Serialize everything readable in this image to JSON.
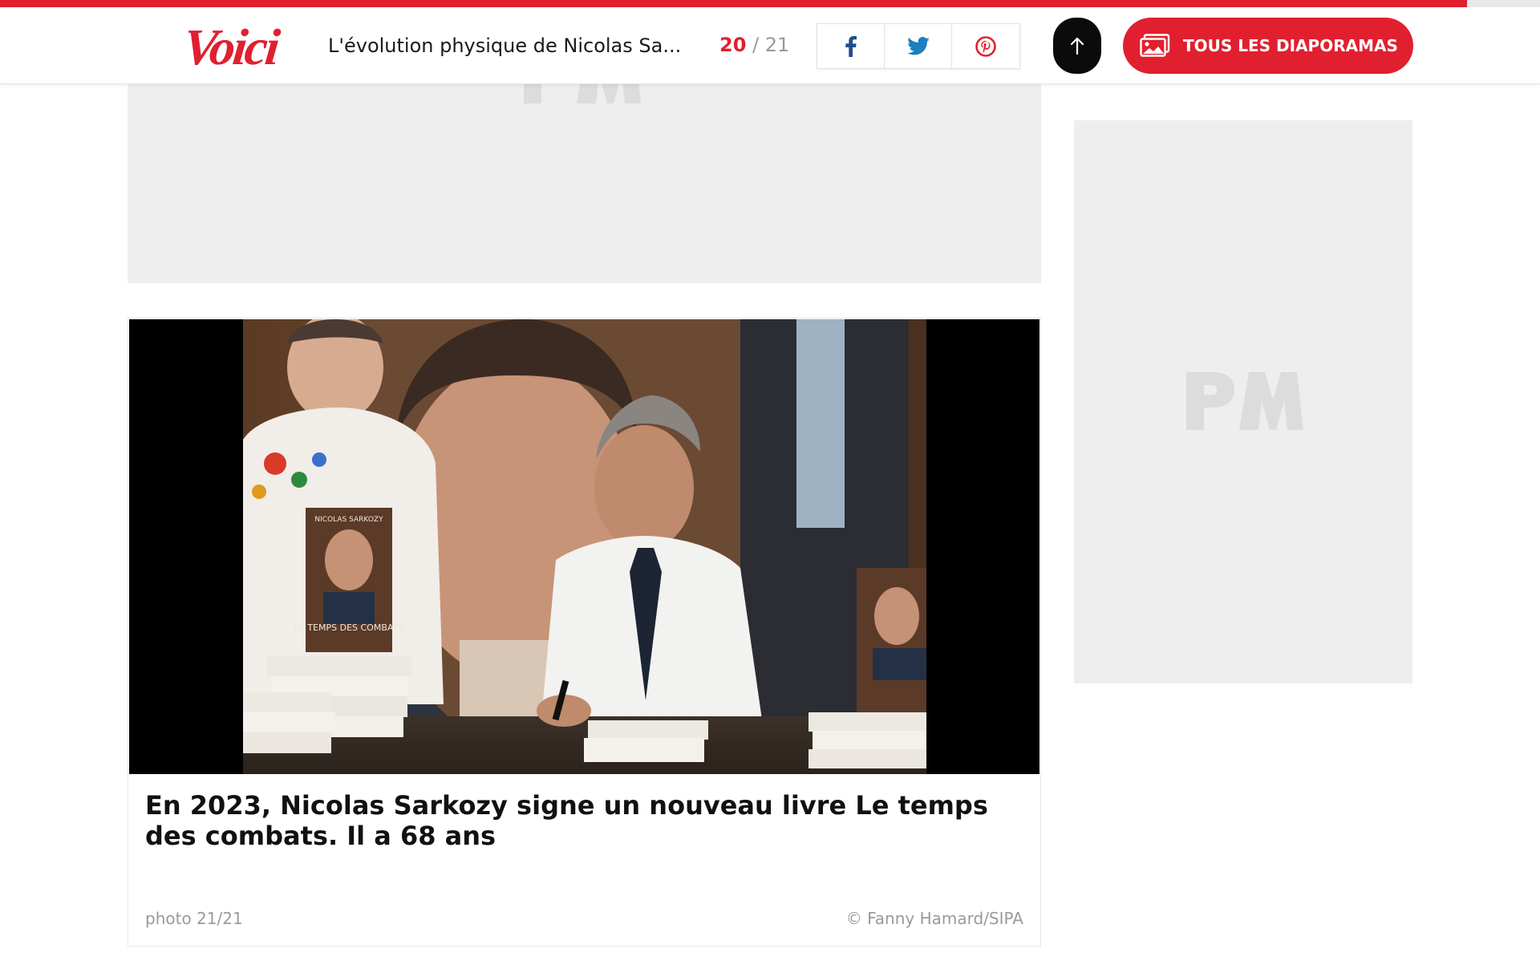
{
  "progress": {
    "fraction": 0.9524
  },
  "header": {
    "logo": "Voici",
    "slide_title": "L'évolution physique de Nicolas Sa...",
    "counter": {
      "current": "20",
      "separator": " / ",
      "total": "21"
    },
    "share": [
      {
        "network": "facebook",
        "icon": "facebook-icon"
      },
      {
        "network": "twitter",
        "icon": "twitter-icon"
      },
      {
        "network": "pinterest",
        "icon": "pinterest-icon"
      }
    ],
    "scroll_top_icon": "arrow-up-icon",
    "all_slides_icon": "gallery-icon",
    "all_slides_label": "TOUS LES DIAPORAMAS"
  },
  "ads": {
    "placeholder_logo": "PM"
  },
  "slide": {
    "photo_cover_author": "NICOLAS SARKOZY",
    "photo_cover_title": "LE TEMPS DES COMBATS",
    "caption": "En 2023, Nicolas Sarkozy signe un nouveau livre Le temps des combats. Il a 68 ans",
    "photo_index": "photo 21/21",
    "credit": "© Fanny Hamard/SIPA"
  },
  "colors": {
    "brand": "#e0202f",
    "placeholder_bg": "#eeeeee",
    "muted_text": "#9a9a9a"
  }
}
